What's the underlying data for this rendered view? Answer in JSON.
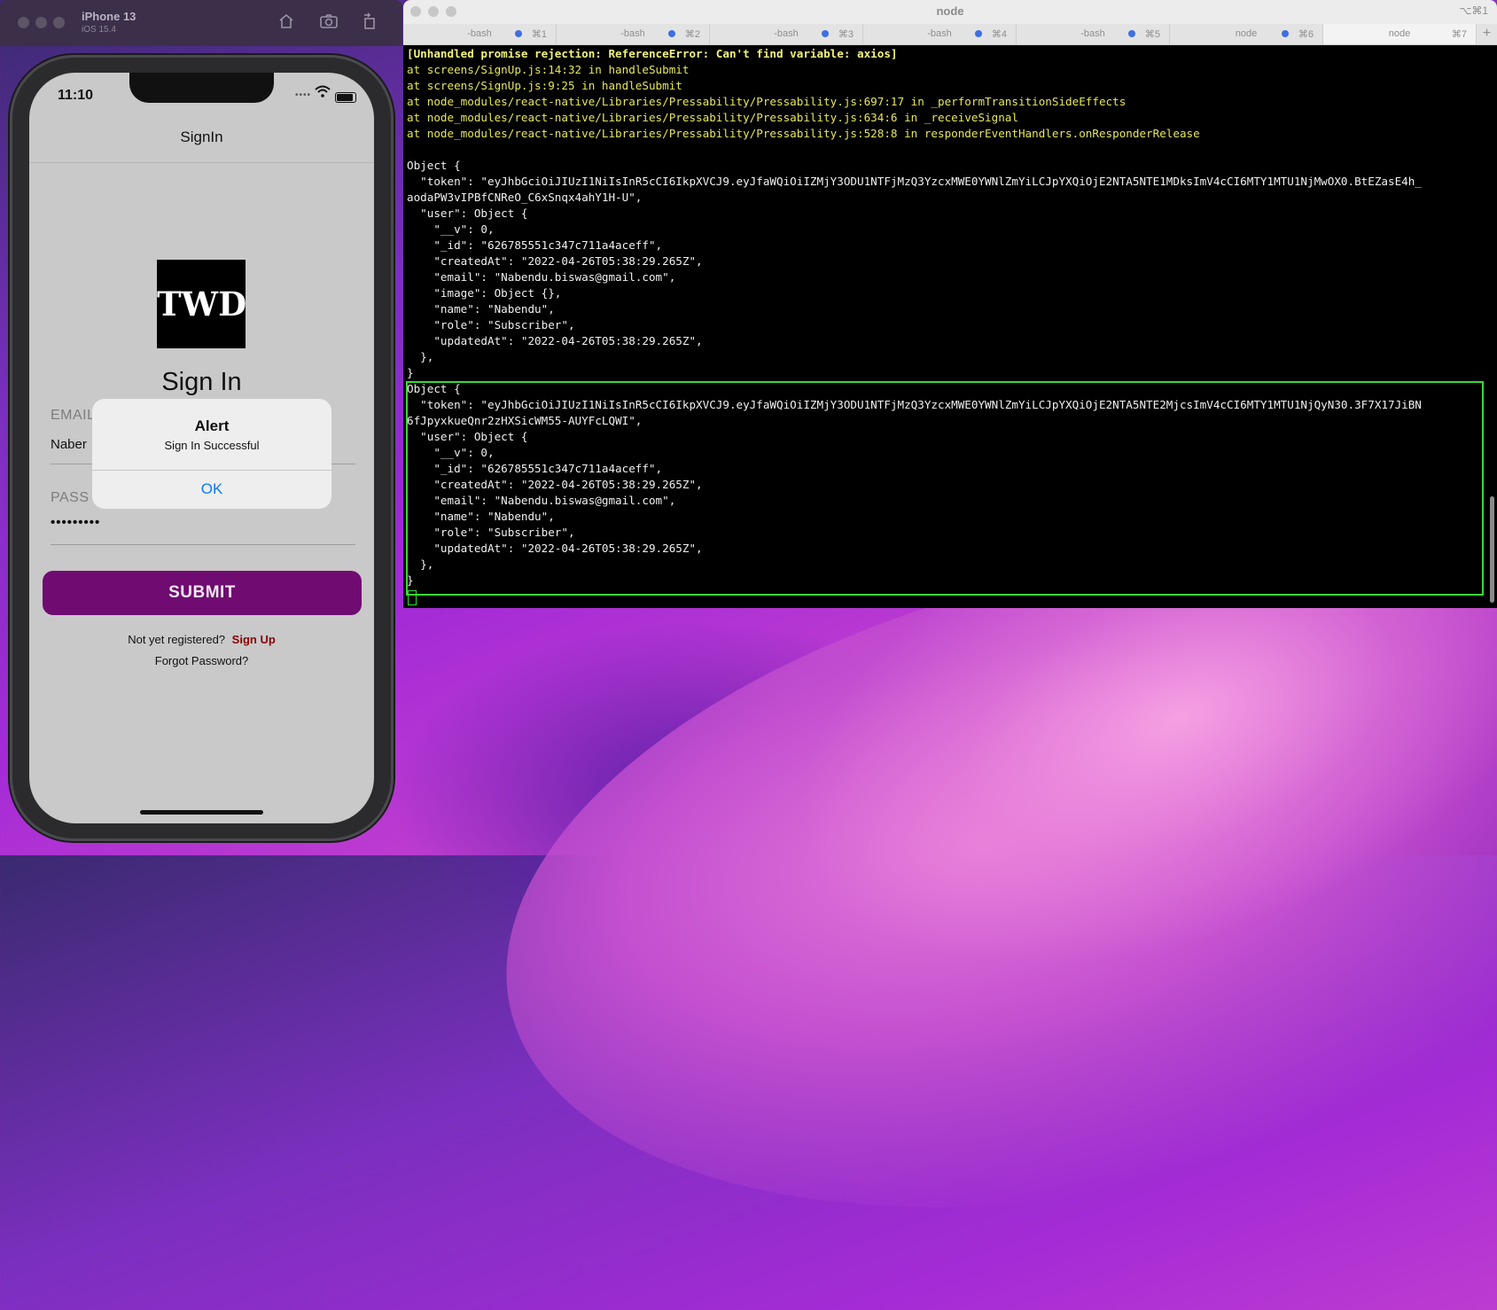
{
  "simulator": {
    "device": "iPhone 13",
    "os": "iOS 15.4",
    "icons": [
      "home-icon",
      "screenshot-icon",
      "rotate-icon"
    ]
  },
  "phone": {
    "time": "11:10",
    "nav_title": "SignIn",
    "logo_text": "TWD",
    "heading": "Sign In",
    "email_label": "EMAIL",
    "email_value": "Naber",
    "password_label": "PASS",
    "password_value": "•••••••••",
    "submit_label": "SUBMIT",
    "register_text": "Not yet registered?",
    "signup_link": "Sign Up",
    "forgot_link": "Forgot Password?",
    "alert": {
      "title": "Alert",
      "message": "Sign In Successful",
      "ok": "OK"
    }
  },
  "terminal": {
    "title": "node",
    "shortcut": "⌥⌘1",
    "tabs": [
      {
        "name": "-bash",
        "shortcut": "⌘1",
        "active": false
      },
      {
        "name": "-bash",
        "shortcut": "⌘2",
        "active": false
      },
      {
        "name": "-bash",
        "shortcut": "⌘3",
        "active": false
      },
      {
        "name": "-bash",
        "shortcut": "⌘4",
        "active": false
      },
      {
        "name": "-bash",
        "shortcut": "⌘5",
        "active": false
      },
      {
        "name": "node",
        "shortcut": "⌘6",
        "active": false
      },
      {
        "name": "node",
        "shortcut": "⌘7",
        "active": true
      }
    ],
    "lines": [
      {
        "t": "[Unhandled promise rejection: ReferenceError: Can't find variable: axios]",
        "c": "err"
      },
      {
        "t": "at screens/SignUp.js:14:32 in handleSubmit",
        "c": "warn"
      },
      {
        "t": "at screens/SignUp.js:9:25 in handleSubmit",
        "c": "warn"
      },
      {
        "t": "at node_modules/react-native/Libraries/Pressability/Pressability.js:697:17 in _performTransitionSideEffects",
        "c": "warn"
      },
      {
        "t": "at node_modules/react-native/Libraries/Pressability/Pressability.js:634:6 in _receiveSignal",
        "c": "warn"
      },
      {
        "t": "at node_modules/react-native/Libraries/Pressability/Pressability.js:528:8 in responderEventHandlers.onResponderRelease",
        "c": "warn"
      },
      {
        "t": "",
        "c": ""
      },
      {
        "t": "Object {",
        "c": ""
      },
      {
        "t": "  \"token\": \"eyJhbGciOiJIUzI1NiIsInR5cCI6IkpXVCJ9.eyJfaWQiOiIZMjY3ODU1NTFjMzQ3YzcxMWE0YWNlZmYiLCJpYXQiOjE2NTA5NTE1MDksImV4cCI6MTY1MTU1NjMwOX0.BtEZasE4h_",
        "c": ""
      },
      {
        "t": "aodaPW3vIPBfCNReO_C6xSnqx4ahY1H-U\",",
        "c": ""
      },
      {
        "t": "  \"user\": Object {",
        "c": ""
      },
      {
        "t": "    \"__v\": 0,",
        "c": ""
      },
      {
        "t": "    \"_id\": \"626785551c347c711a4aceff\",",
        "c": ""
      },
      {
        "t": "    \"createdAt\": \"2022-04-26T05:38:29.265Z\",",
        "c": ""
      },
      {
        "t": "    \"email\": \"Nabendu.biswas@gmail.com\",",
        "c": ""
      },
      {
        "t": "    \"image\": Object {},",
        "c": ""
      },
      {
        "t": "    \"name\": \"Nabendu\",",
        "c": ""
      },
      {
        "t": "    \"role\": \"Subscriber\",",
        "c": ""
      },
      {
        "t": "    \"updatedAt\": \"2022-04-26T05:38:29.265Z\",",
        "c": ""
      },
      {
        "t": "  },",
        "c": ""
      },
      {
        "t": "}",
        "c": ""
      },
      {
        "t": "Object {",
        "c": ""
      },
      {
        "t": "  \"token\": \"eyJhbGciOiJIUzI1NiIsInR5cCI6IkpXVCJ9.eyJfaWQiOiIZMjY3ODU1NTFjMzQ3YzcxMWE0YWNlZmYiLCJpYXQiOjE2NTA5NTE2MjcsImV4cCI6MTY1MTU1NjQyN30.3F7X17JiBN",
        "c": ""
      },
      {
        "t": "6fJpyxkueQnr2zHXSicWM55-AUYFcLQWI\",",
        "c": ""
      },
      {
        "t": "  \"user\": Object {",
        "c": ""
      },
      {
        "t": "    \"__v\": 0,",
        "c": ""
      },
      {
        "t": "    \"_id\": \"626785551c347c711a4aceff\",",
        "c": ""
      },
      {
        "t": "    \"createdAt\": \"2022-04-26T05:38:29.265Z\",",
        "c": ""
      },
      {
        "t": "    \"email\": \"Nabendu.biswas@gmail.com\",",
        "c": ""
      },
      {
        "t": "    \"name\": \"Nabendu\",",
        "c": ""
      },
      {
        "t": "    \"role\": \"Subscriber\",",
        "c": ""
      },
      {
        "t": "    \"updatedAt\": \"2022-04-26T05:38:29.265Z\",",
        "c": ""
      },
      {
        "t": "  },",
        "c": ""
      },
      {
        "t": "}",
        "c": ""
      }
    ]
  },
  "colors": {
    "submit": "#6f0b71",
    "signup_link": "#8a0000",
    "alert_button": "#0a79ff",
    "selection": "#38d838",
    "error_text": "#f3f37a"
  }
}
